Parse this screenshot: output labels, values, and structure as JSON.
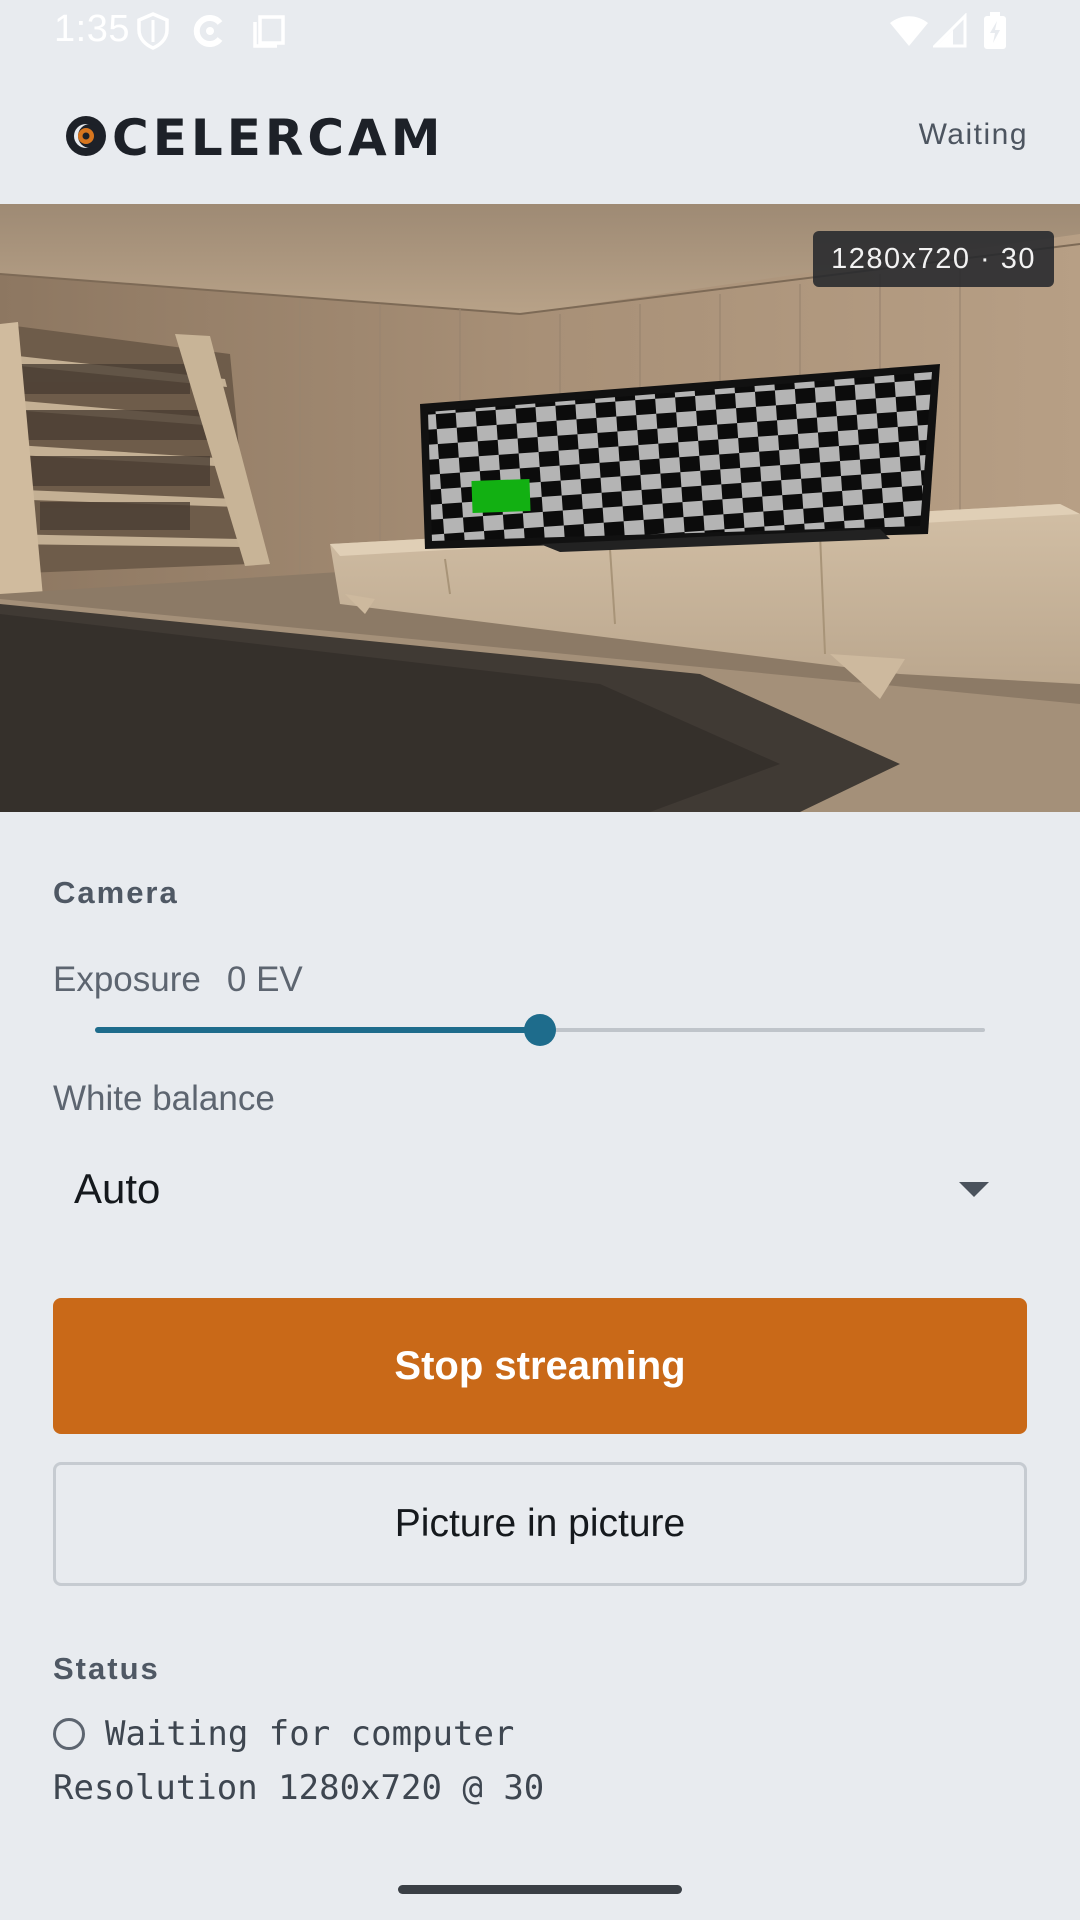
{
  "status_bar": {
    "time": "1:35",
    "icons": [
      "shield-icon",
      "celercam-notification-icon",
      "copy-icon",
      "wifi-icon",
      "cell-signal-icon",
      "battery-charging-icon"
    ]
  },
  "header": {
    "logo_text": "CELERCAM",
    "connection_status": "Waiting"
  },
  "preview": {
    "badge": "1280x720 · 30"
  },
  "camera": {
    "section_title": "Camera",
    "exposure_label": "Exposure",
    "exposure_value": "0 EV",
    "exposure_position": 0.5,
    "white_balance_label": "White balance",
    "white_balance_value": "Auto"
  },
  "actions": {
    "stop_streaming": "Stop streaming",
    "picture_in_picture": "Picture in picture"
  },
  "status": {
    "section_title": "Status",
    "connection_line": "Waiting for computer",
    "resolution_line": "Resolution 1280x720 @ 30"
  },
  "colors": {
    "accent_orange": "#c96918",
    "slider_blue": "#1e6c8c",
    "background": "#e8ebef"
  }
}
